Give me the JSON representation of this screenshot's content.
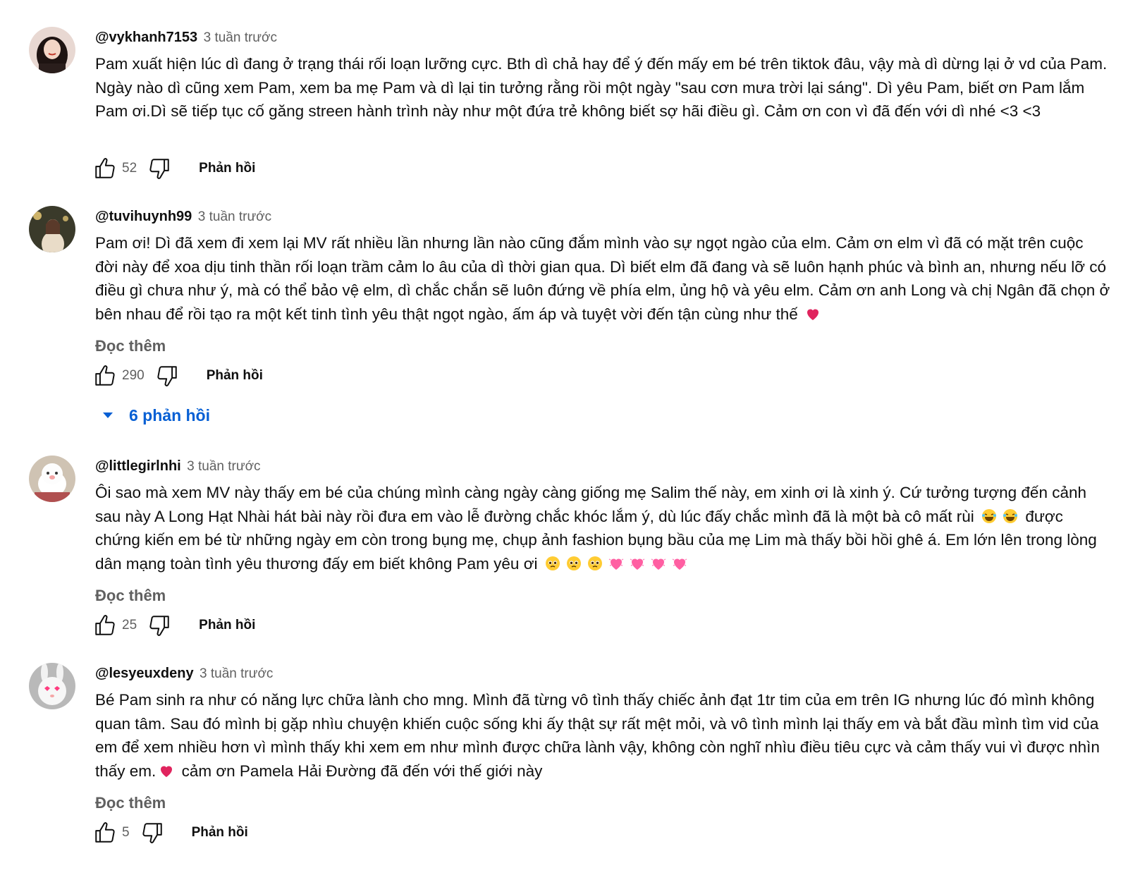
{
  "comments": [
    {
      "author": "@vykhanh7153",
      "time": "3 tuần trước",
      "text": "Pam xuất hiện lúc dì đang ở trạng thái rối loạn lưỡng cực. Bth dì chả hay để ý đến mấy em bé trên tiktok đâu, vậy mà dì dừng lại ở vd của Pam. Ngày nào dì cũng xem Pam, xem ba mẹ Pam và dì lại tin tưởng rằng rồi một ngày \"sau cơn mưa trời lại sáng\". Dì yêu Pam, biết ơn Pam lắm Pam ơi.Dì sẽ tiếp tục cố găng streen hành trình này như một đứa trẻ không biết sợ hãi điều gì. Cảm ơn con vì đã đến với dì nhé <3 <3",
      "likes": "52",
      "reply_label": "Phản hồi",
      "avatar_icon": "avatar-girl-icon"
    },
    {
      "author": "@tuvihuynh99",
      "time": "3 tuần trước",
      "text": "Pam ơi! Dì đã xem đi xem lại MV rất nhiều lần nhưng lần nào cũng đắm mình vào sự ngọt ngào của elm. Cảm ơn elm vì đã có mặt trên cuộc đời này để xoa dịu tinh thần rối loạn trầm cảm lo âu của dì thời gian qua. Dì biết elm đã đang và sẽ luôn hạnh phúc và bình an, nhưng nếu lỡ có điều gì chưa như ý, mà có thể bảo vệ elm, dì chắc chắn sẽ luôn đứng về phía elm, ủng hộ và yêu elm. Cảm ơn anh Long và chị Ngân đã chọn ở bên nhau để rồi tạo ra một kết tinh tình yêu thật ngọt ngào, ấm áp và tuyệt vời đến tận cùng như thế",
      "read_more": "Đọc thêm",
      "likes": "290",
      "reply_label": "Phản hồi",
      "replies_toggle": "6 phản hồi",
      "avatar_icon": "avatar-photo-icon"
    },
    {
      "author": "@littlegirlnhi",
      "time": "3 tuần trước",
      "text_a": "Ôi sao mà xem MV này thấy em bé của chúng mình càng ngày càng giống mẹ Salim thế này, em xinh ơi là xinh ý. Cứ tưởng tượng đến cảnh sau này A Long Hạt Nhài hát bài này rồi đưa em vào lễ đường chắc khóc lắm ý, dù lúc đấy chắc mình đã là một bà cô mất rùi",
      "text_b": "được chứng kiến em bé từ những ngày em còn trong bụng mẹ, chụp ảnh fashion bụng bầu của mẹ Lim mà thấy bồi hồi ghê á. Em lớn lên trong lòng dân mạng toàn tình yêu thương đấy em biết không Pam yêu ơi",
      "read_more": "Đọc thêm",
      "likes": "25",
      "reply_label": "Phản hồi",
      "avatar_icon": "avatar-cartoon-icon"
    },
    {
      "author": "@lesyeuxdeny",
      "time": "3 tuần trước",
      "text_a": "Bé Pam sinh ra như có năng lực chữa lành cho mng. Mình đã từng vô tình thấy chiếc ảnh đạt 1tr tim của em trên IG nhưng lúc đó mình không quan tâm. Sau đó mình bị gặp nhìu chuyện khiến cuộc sống khi ấy thật sự rất mệt mỏi, và vô tình mình lại thấy em và bắt đầu mình tìm vid của em để xem nhiều hơn vì mình thấy khi xem em như mình được chữa lành vậy, không còn nghĩ nhìu điều tiêu cực và cảm thấy vui vì được nhìn thấy em.",
      "text_b": "cảm ơn Pamela Hải Đường đã đến với thế giới này",
      "read_more": "Đọc thêm",
      "likes": "5",
      "reply_label": "Phản hồi",
      "avatar_icon": "avatar-bunny-icon"
    }
  ],
  "colors": {
    "link_blue": "#065fd4",
    "meta_gray": "#606060",
    "heart_red": "#e0245e",
    "pink_heart": "#ff5fa2"
  }
}
